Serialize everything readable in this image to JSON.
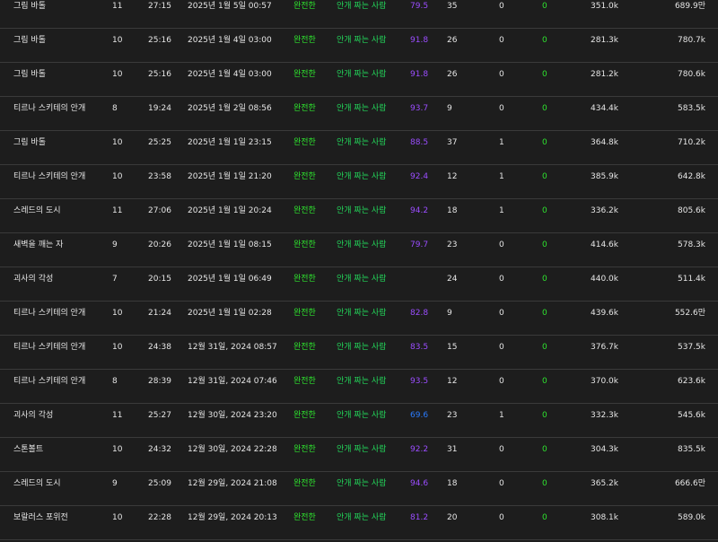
{
  "colors": {
    "background": "#1d1d1d",
    "text": "#e6e6e6",
    "status_green": "#2ee32e",
    "role_green": "#23d65a",
    "score_purple": "#9b4dff",
    "score_blue": "#2a7cff",
    "divider": "#3a3a3a"
  },
  "rows": [
    {
      "name": "그림 바톨",
      "level": "11",
      "time": "27:15",
      "date": "2025년 1월 5일 00:57",
      "status": "완전한",
      "role": "안개 짜는 사람",
      "score": "79.5",
      "score_color": "#9b4dff",
      "col_a": "35",
      "col_b": "0",
      "col_c": "0",
      "col_d": "351.0k",
      "col_e": "689.9만"
    },
    {
      "name": "그림 바톨",
      "level": "10",
      "time": "25:16",
      "date": "2025년 1월 4일 03:00",
      "status": "완전한",
      "role": "안개 짜는 사람",
      "score": "91.8",
      "score_color": "#9b4dff",
      "col_a": "26",
      "col_b": "0",
      "col_c": "0",
      "col_d": "281.3k",
      "col_e": "780.7k"
    },
    {
      "name": "그림 바톨",
      "level": "10",
      "time": "25:16",
      "date": "2025년 1월 4일 03:00",
      "status": "완전한",
      "role": "안개 짜는 사람",
      "score": "91.8",
      "score_color": "#9b4dff",
      "col_a": "26",
      "col_b": "0",
      "col_c": "0",
      "col_d": "281.2k",
      "col_e": "780.6k"
    },
    {
      "name": "티르나 스키테의 안개",
      "level": "8",
      "time": "19:24",
      "date": "2025년 1월 2일 08:56",
      "status": "완전한",
      "role": "안개 짜는 사람",
      "score": "93.7",
      "score_color": "#9b4dff",
      "col_a": "9",
      "col_b": "0",
      "col_c": "0",
      "col_d": "434.4k",
      "col_e": "583.5k"
    },
    {
      "name": "그림 바톨",
      "level": "10",
      "time": "25:25",
      "date": "2025년 1월 1일 23:15",
      "status": "완전한",
      "role": "안개 짜는 사람",
      "score": "88.5",
      "score_color": "#9b4dff",
      "col_a": "37",
      "col_b": "1",
      "col_c": "0",
      "col_d": "364.8k",
      "col_e": "710.2k"
    },
    {
      "name": "티르나 스키테의 안개",
      "level": "10",
      "time": "23:58",
      "date": "2025년 1월 1일 21:20",
      "status": "완전한",
      "role": "안개 짜는 사람",
      "score": "92.4",
      "score_color": "#9b4dff",
      "col_a": "12",
      "col_b": "1",
      "col_c": "0",
      "col_d": "385.9k",
      "col_e": "642.8k"
    },
    {
      "name": "스레드의 도시",
      "level": "11",
      "time": "27:06",
      "date": "2025년 1월 1일 20:24",
      "status": "완전한",
      "role": "안개 짜는 사람",
      "score": "94.2",
      "score_color": "#9b4dff",
      "col_a": "18",
      "col_b": "1",
      "col_c": "0",
      "col_d": "336.2k",
      "col_e": "805.6k"
    },
    {
      "name": "새벽을 깨는 자",
      "level": "9",
      "time": "20:26",
      "date": "2025년 1월 1일 08:15",
      "status": "완전한",
      "role": "안개 짜는 사람",
      "score": "79.7",
      "score_color": "#9b4dff",
      "col_a": "23",
      "col_b": "0",
      "col_c": "0",
      "col_d": "414.6k",
      "col_e": "578.3k"
    },
    {
      "name": "괴사의 각성",
      "level": "7",
      "time": "20:15",
      "date": "2025년 1월 1일 06:49",
      "status": "완전한",
      "role": "안개 짜는 사람",
      "score": "",
      "score_color": "#9b4dff",
      "col_a": "24",
      "col_b": "0",
      "col_c": "0",
      "col_d": "440.0k",
      "col_e": "511.4k"
    },
    {
      "name": "티르나 스키테의 안개",
      "level": "10",
      "time": "21:24",
      "date": "2025년 1월 1일 02:28",
      "status": "완전한",
      "role": "안개 짜는 사람",
      "score": "82.8",
      "score_color": "#9b4dff",
      "col_a": "9",
      "col_b": "0",
      "col_c": "0",
      "col_d": "439.6k",
      "col_e": "552.6만"
    },
    {
      "name": "티르나 스키테의 안개",
      "level": "10",
      "time": "24:38",
      "date": "12월 31일, 2024 08:57",
      "status": "완전한",
      "role": "안개 짜는 사람",
      "score": "83.5",
      "score_color": "#9b4dff",
      "col_a": "15",
      "col_b": "0",
      "col_c": "0",
      "col_d": "376.7k",
      "col_e": "537.5k"
    },
    {
      "name": "티르나 스키테의 안개",
      "level": "8",
      "time": "28:39",
      "date": "12월 31일, 2024 07:46",
      "status": "완전한",
      "role": "안개 짜는 사람",
      "score": "93.5",
      "score_color": "#9b4dff",
      "col_a": "12",
      "col_b": "0",
      "col_c": "0",
      "col_d": "370.0k",
      "col_e": "623.6k"
    },
    {
      "name": "괴사의 각성",
      "level": "11",
      "time": "25:27",
      "date": "12월 30일, 2024 23:20",
      "status": "완전한",
      "role": "안개 짜는 사람",
      "score": "69.6",
      "score_color": "#2a7cff",
      "col_a": "23",
      "col_b": "1",
      "col_c": "0",
      "col_d": "332.3k",
      "col_e": "545.6k"
    },
    {
      "name": "스톤볼트",
      "level": "10",
      "time": "24:32",
      "date": "12월 30일, 2024 22:28",
      "status": "완전한",
      "role": "안개 짜는 사람",
      "score": "92.2",
      "score_color": "#9b4dff",
      "col_a": "31",
      "col_b": "0",
      "col_c": "0",
      "col_d": "304.3k",
      "col_e": "835.5k"
    },
    {
      "name": "스레드의 도시",
      "level": "9",
      "time": "25:09",
      "date": "12월 29일, 2024 21:08",
      "status": "완전한",
      "role": "안개 짜는 사람",
      "score": "94.6",
      "score_color": "#9b4dff",
      "col_a": "18",
      "col_b": "0",
      "col_c": "0",
      "col_d": "365.2k",
      "col_e": "666.6만"
    },
    {
      "name": "보랄러스 포위전",
      "level": "10",
      "time": "22:28",
      "date": "12월 29일, 2024 20:13",
      "status": "완전한",
      "role": "안개 짜는 사람",
      "score": "81.2",
      "score_color": "#9b4dff",
      "col_a": "20",
      "col_b": "0",
      "col_c": "0",
      "col_d": "308.1k",
      "col_e": "589.0k"
    }
  ]
}
